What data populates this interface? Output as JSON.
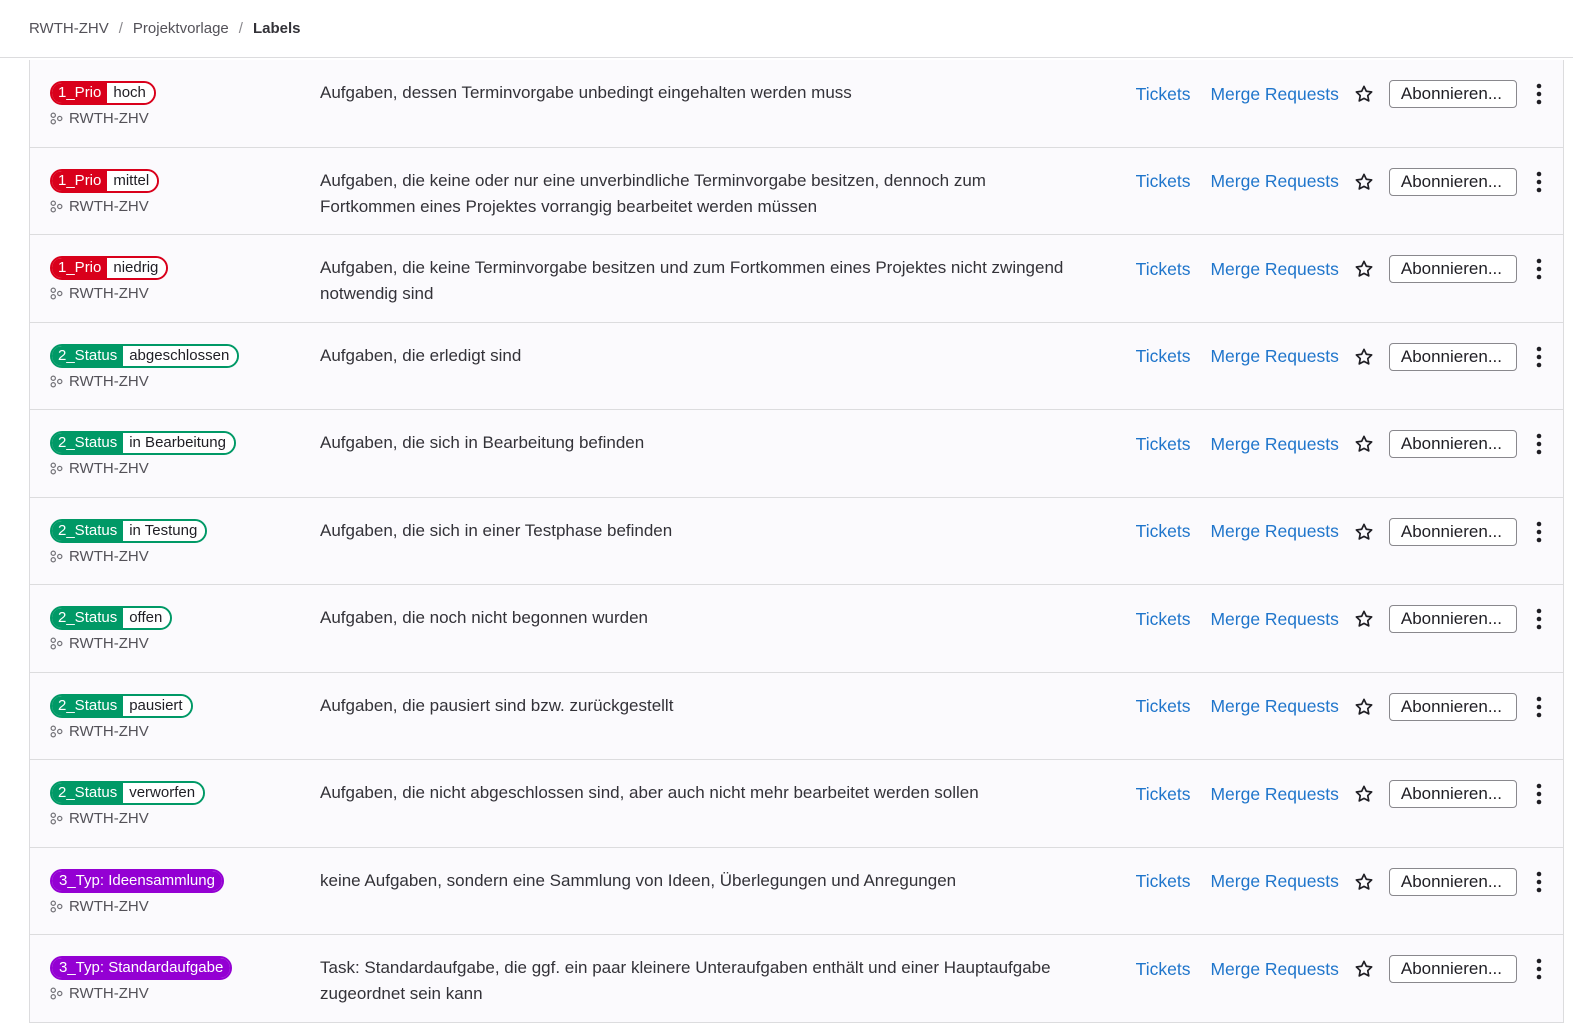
{
  "breadcrumb": {
    "items": [
      "RWTH-ZHV",
      "Projektvorlage"
    ],
    "current": "Labels",
    "separator": "/"
  },
  "actions": {
    "tickets": "Tickets",
    "merge_requests": "Merge Requests",
    "subscribe": "Abonnieren..."
  },
  "labels": [
    {
      "key": "1_Prio",
      "value": "hoch",
      "color": "#d9001b",
      "group": "RWTH-ZHV",
      "description": "Aufgaben, dessen Terminvorgabe unbedingt eingehalten werden muss"
    },
    {
      "key": "1_Prio",
      "value": "mittel",
      "color": "#d9001b",
      "group": "RWTH-ZHV",
      "description": "Aufgaben, die keine oder nur eine unverbindliche Terminvorgabe besitzen, dennoch zum Fortkommen eines Projektes vorrangig bearbeitet werden müssen"
    },
    {
      "key": "1_Prio",
      "value": "niedrig",
      "color": "#d9001b",
      "group": "RWTH-ZHV",
      "description": "Aufgaben, die keine Terminvorgabe besitzen und zum Fortkommen eines Projektes nicht zwingend notwendig sind"
    },
    {
      "key": "2_Status",
      "value": "abgeschlossen",
      "color": "#009966",
      "group": "RWTH-ZHV",
      "description": "Aufgaben, die erledigt sind"
    },
    {
      "key": "2_Status",
      "value": "in Bearbeitung",
      "color": "#009966",
      "group": "RWTH-ZHV",
      "description": "Aufgaben, die sich in Bearbeitung befinden"
    },
    {
      "key": "2_Status",
      "value": "in Testung",
      "color": "#009966",
      "group": "RWTH-ZHV",
      "description": "Aufgaben, die sich in einer Testphase befinden"
    },
    {
      "key": "2_Status",
      "value": "offen",
      "color": "#009966",
      "group": "RWTH-ZHV",
      "description": "Aufgaben, die noch nicht begonnen wurden"
    },
    {
      "key": "2_Status",
      "value": "pausiert",
      "color": "#009966",
      "group": "RWTH-ZHV",
      "description": "Aufgaben, die pausiert sind bzw. zurückgestellt"
    },
    {
      "key": "2_Status",
      "value": "verworfen",
      "color": "#009966",
      "group": "RWTH-ZHV",
      "description": "Aufgaben, die nicht abgeschlossen sind, aber auch nicht mehr bearbeitet werden sollen"
    },
    {
      "key": "3_Typ: Ideensammlung",
      "value": "",
      "color": "#9400d3",
      "group": "RWTH-ZHV",
      "description": "keine Aufgaben, sondern eine Sammlung von Ideen, Überlegungen und Anregungen"
    },
    {
      "key": "3_Typ: Standardaufgabe",
      "value": "",
      "color": "#9400d3",
      "group": "RWTH-ZHV",
      "description": "Task: Standardaufgabe, die ggf. ein paar kleinere Unteraufgaben enthält und einer Hauptaufgabe zugeordnet sein kann"
    }
  ],
  "icons": {
    "group": "group-icon",
    "star": "star-icon",
    "more": "more-actions-icon"
  }
}
